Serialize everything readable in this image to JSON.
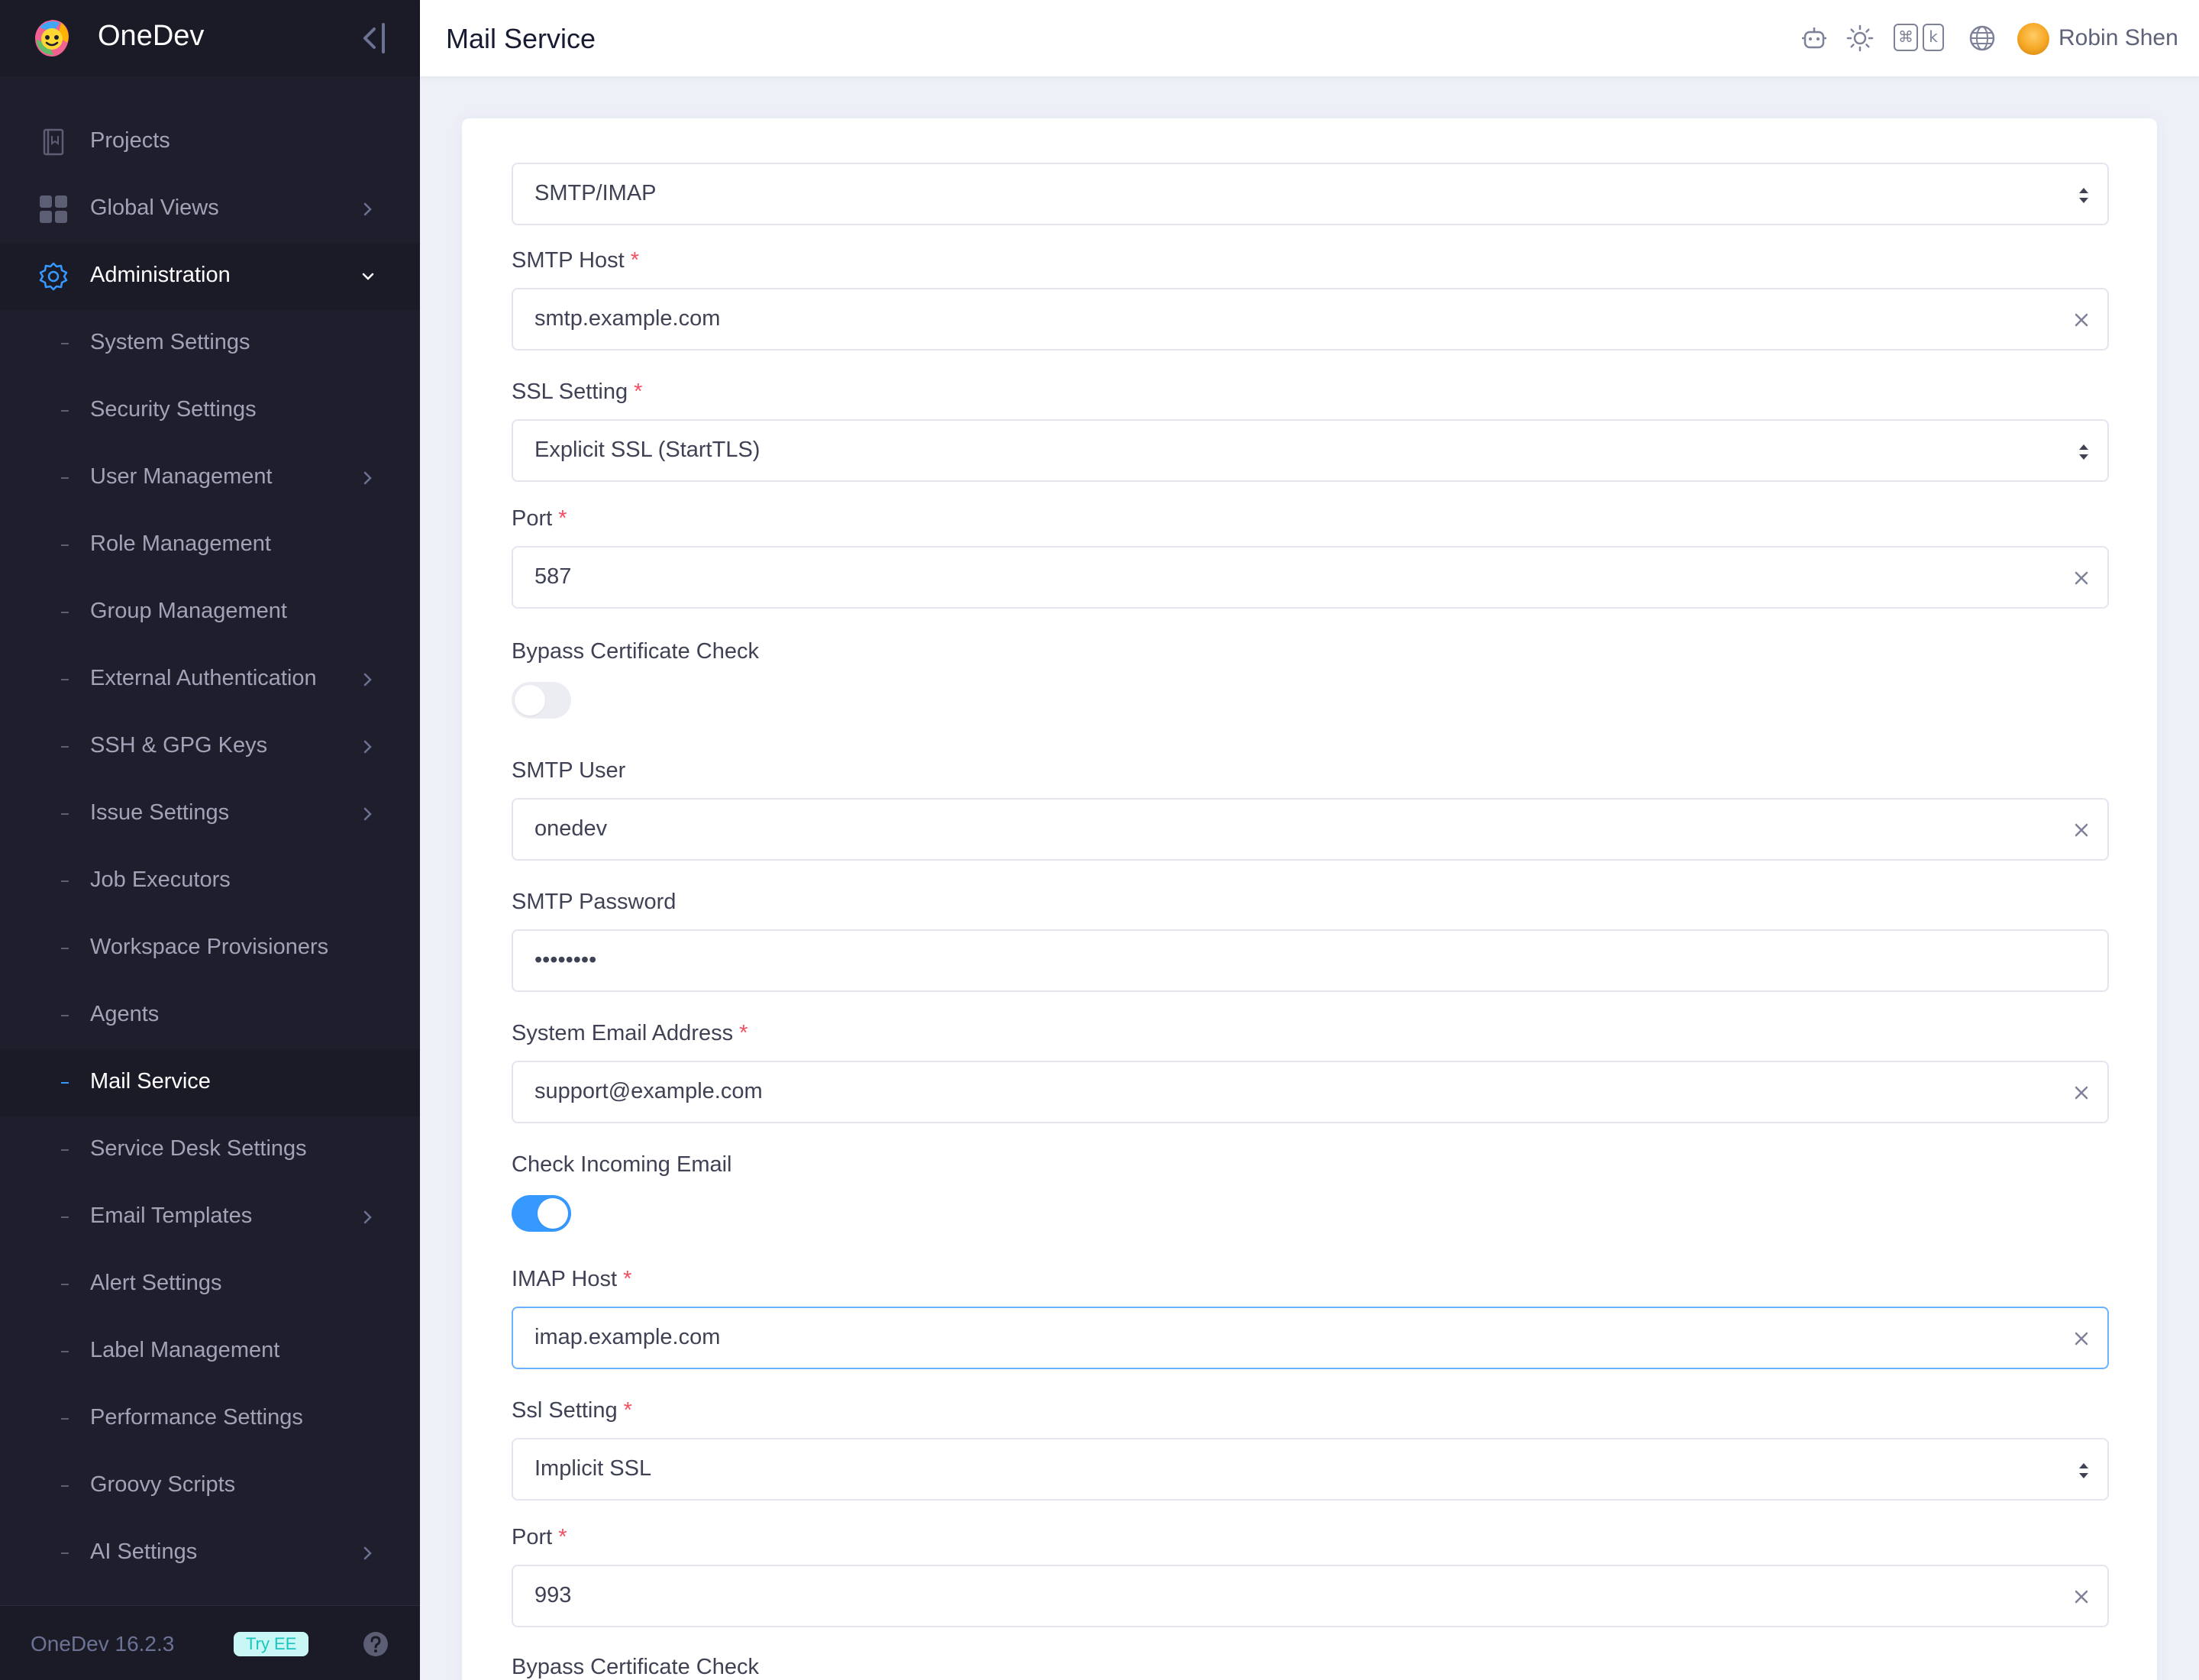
{
  "app": {
    "name": "OneDev",
    "version": "OneDev 16.2.3",
    "try_ee": "Try EE"
  },
  "header": {
    "title": "Mail Service",
    "kbd_cmd": "⌘",
    "kbd_key": "k",
    "user_name": "Robin Shen"
  },
  "sidebar": {
    "items": [
      {
        "label": "Projects"
      },
      {
        "label": "Global Views"
      },
      {
        "label": "Administration"
      },
      {
        "label": "System Settings"
      },
      {
        "label": "Security Settings"
      },
      {
        "label": "User Management"
      },
      {
        "label": "Role Management"
      },
      {
        "label": "Group Management"
      },
      {
        "label": "External Authentication"
      },
      {
        "label": "SSH & GPG Keys"
      },
      {
        "label": "Issue Settings"
      },
      {
        "label": "Job Executors"
      },
      {
        "label": "Workspace Provisioners"
      },
      {
        "label": "Agents"
      },
      {
        "label": "Mail Service"
      },
      {
        "label": "Service Desk Settings"
      },
      {
        "label": "Email Templates"
      },
      {
        "label": "Alert Settings"
      },
      {
        "label": "Label Management"
      },
      {
        "label": "Performance Settings"
      },
      {
        "label": "Groovy Scripts"
      },
      {
        "label": "AI Settings"
      }
    ]
  },
  "form": {
    "mail_type": "SMTP/IMAP",
    "smtp_host": {
      "label": "SMTP Host",
      "value": "smtp.example.com"
    },
    "ssl_setting": {
      "label": "SSL Setting",
      "value": "Explicit SSL (StartTLS)"
    },
    "port": {
      "label": "Port",
      "value": "587"
    },
    "bypass_cert": {
      "label": "Bypass Certificate Check",
      "enabled": false
    },
    "smtp_user": {
      "label": "SMTP User",
      "value": "onedev"
    },
    "smtp_password": {
      "label": "SMTP Password",
      "value": "••••••••"
    },
    "system_email": {
      "label": "System Email Address",
      "value": "support@example.com"
    },
    "check_incoming": {
      "label": "Check Incoming Email",
      "enabled": true
    },
    "imap_host": {
      "label": "IMAP Host",
      "value": "imap.example.com"
    },
    "imap_ssl": {
      "label": "Ssl Setting",
      "value": "Implicit SSL"
    },
    "imap_port": {
      "label": "Port",
      "value": "993"
    },
    "imap_bypass_cert": {
      "label": "Bypass Certificate Check"
    }
  },
  "colors": {
    "sidebar_bg": "#1e1e2d",
    "accent": "#3699ff",
    "required": "#f64e60"
  }
}
